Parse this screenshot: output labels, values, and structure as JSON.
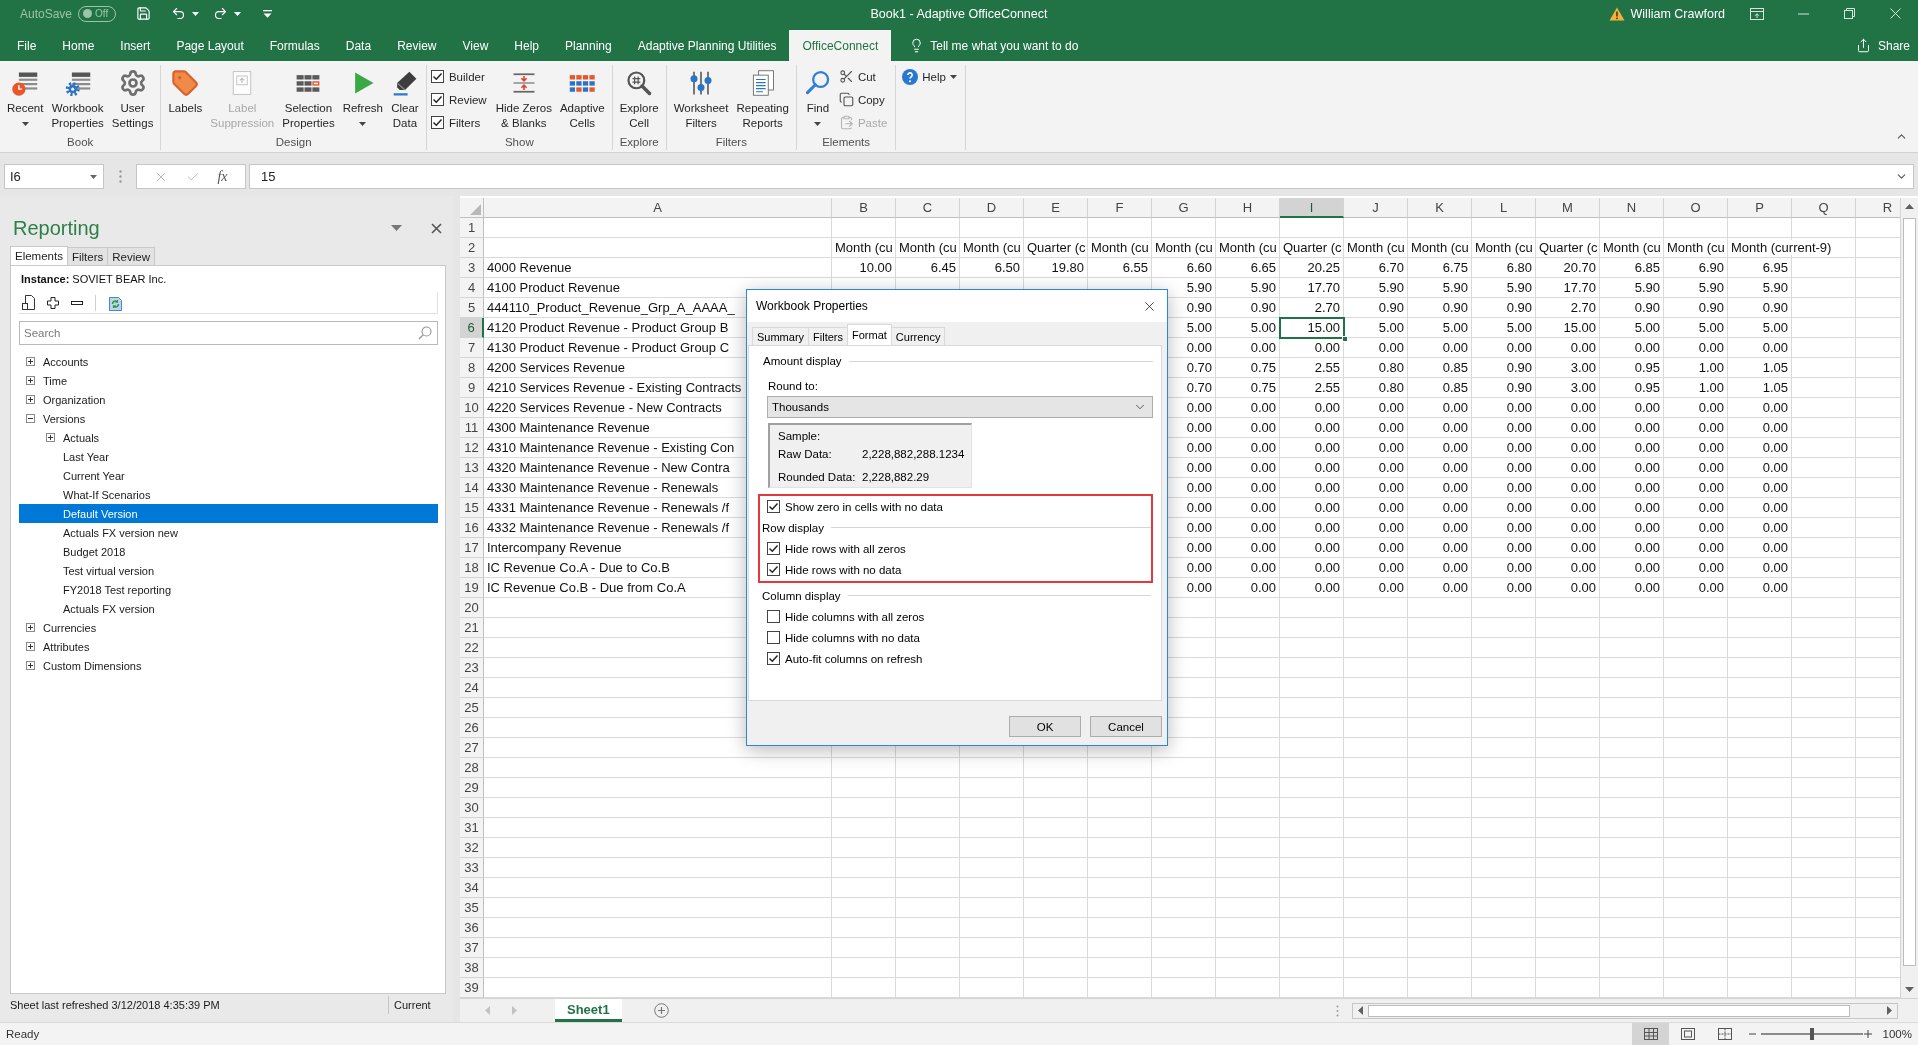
{
  "title_bar": {
    "autosave_label": "AutoSave",
    "autosave_toggle": {
      "label": "Off",
      "on": false
    },
    "title": "Book1 - Adaptive OfficeConnect",
    "user": "William Crawford"
  },
  "menu_tabs": [
    {
      "label": "File",
      "selected": false
    },
    {
      "label": "Home",
      "selected": false
    },
    {
      "label": "Insert",
      "selected": false
    },
    {
      "label": "Page Layout",
      "selected": false
    },
    {
      "label": "Formulas",
      "selected": false
    },
    {
      "label": "Data",
      "selected": false
    },
    {
      "label": "Review",
      "selected": false
    },
    {
      "label": "View",
      "selected": false
    },
    {
      "label": "Help",
      "selected": false
    },
    {
      "label": "Planning",
      "selected": false
    },
    {
      "label": "Adaptive Planning Utilities",
      "selected": false
    },
    {
      "label": "OfficeConnect",
      "selected": true
    }
  ],
  "tell_me": "Tell me what you want to do",
  "share": "Share",
  "ribbon": {
    "groups": [
      {
        "label": "Book",
        "items": [
          {
            "kind": "large",
            "label": "Recent",
            "dropdown": true,
            "disabled": false
          },
          {
            "kind": "large",
            "label": "Workbook\nProperties",
            "dropdown": false,
            "disabled": false
          },
          {
            "kind": "large",
            "label": "User\nSettings",
            "dropdown": false,
            "disabled": false
          }
        ]
      },
      {
        "label": "Design",
        "items": [
          {
            "kind": "large",
            "label": "Labels",
            "dropdown": false,
            "disabled": false
          },
          {
            "kind": "large",
            "label": "Label\nSuppression",
            "dropdown": false,
            "disabled": true
          },
          {
            "kind": "large",
            "label": "Selection\nProperties",
            "dropdown": false,
            "disabled": false
          },
          {
            "kind": "large",
            "label": "Refresh",
            "dropdown": true,
            "disabled": false
          },
          {
            "kind": "large",
            "label": "Clear\nData",
            "dropdown": false,
            "disabled": false
          }
        ]
      },
      {
        "label": "Show",
        "items": [
          {
            "kind": "check",
            "label": "Builder",
            "checked": true
          },
          {
            "kind": "check",
            "label": "Review",
            "checked": true
          },
          {
            "kind": "check",
            "label": "Filters",
            "checked": true
          },
          {
            "kind": "large",
            "label": "Hide Zeros\n& Blanks",
            "dropdown": false,
            "disabled": false
          },
          {
            "kind": "large",
            "label": "Adaptive\nCells",
            "dropdown": false,
            "disabled": false
          }
        ]
      },
      {
        "label": "Explore",
        "items": [
          {
            "kind": "large",
            "label": "Explore\nCell",
            "dropdown": false,
            "disabled": false
          }
        ]
      },
      {
        "label": "Filters",
        "items": [
          {
            "kind": "large",
            "label": "Worksheet\nFilters",
            "dropdown": false,
            "disabled": false
          },
          {
            "kind": "large",
            "label": "Repeating\nReports",
            "dropdown": false,
            "disabled": false
          }
        ]
      },
      {
        "label": "Elements",
        "items": [
          {
            "kind": "large",
            "label": "Find",
            "dropdown": true,
            "disabled": false
          },
          {
            "kind": "small",
            "label": "Cut",
            "dropdown": false,
            "disabled": false
          },
          {
            "kind": "small",
            "label": "Copy",
            "dropdown": false,
            "disabled": false
          },
          {
            "kind": "small",
            "label": "Paste",
            "dropdown": false,
            "disabled": true
          }
        ]
      },
      {
        "items": [
          {
            "kind": "small",
            "label": "Help",
            "dropdown": true,
            "disabled": false
          }
        ]
      }
    ]
  },
  "formula_bar": {
    "name_box": "I6",
    "function_label": "fx",
    "formula": "15"
  },
  "task_pane": {
    "title": "Reporting",
    "tabs": [
      {
        "label": "Elements",
        "selected": true
      },
      {
        "label": "Filters",
        "selected": false
      },
      {
        "label": "Review",
        "selected": false
      }
    ],
    "instance": "**Instance:** SOVIET BEAR Inc.",
    "search": {
      "placeholder": "Search"
    },
    "tree": [
      {
        "kind": "folder",
        "label": "Accounts",
        "expanded": false,
        "selected": false
      },
      {
        "kind": "folder",
        "label": "Time",
        "expanded": false,
        "selected": false
      },
      {
        "kind": "folder",
        "label": "Organization",
        "expanded": false,
        "selected": false
      },
      {
        "kind": "folder",
        "label": "Versions",
        "expanded": true,
        "selected": false,
        "children": [
          {
            "kind": "folder",
            "label": "Actuals",
            "expanded": false,
            "selected": false
          },
          {
            "kind": "leaf",
            "label": "Last Year",
            "selected": false
          },
          {
            "kind": "leaf",
            "label": "Current Year",
            "selected": false
          },
          {
            "kind": "leaf",
            "label": "What-If Scenarios",
            "selected": false
          },
          {
            "kind": "leaf",
            "label": "Default Version",
            "selected": true
          },
          {
            "kind": "leaf",
            "label": "Actuals FX version new",
            "selected": false
          },
          {
            "kind": "leaf",
            "label": "Budget 2018",
            "selected": false
          },
          {
            "kind": "leaf",
            "label": "Test virtual version",
            "selected": false
          },
          {
            "kind": "leaf",
            "label": "FY2018 Test reporting",
            "selected": false
          },
          {
            "kind": "leaf",
            "label": "Actuals FX version",
            "selected": false
          }
        ]
      },
      {
        "kind": "folder",
        "label": "Currencies",
        "expanded": false,
        "selected": false
      },
      {
        "kind": "folder",
        "label": "Attributes",
        "expanded": false,
        "selected": false
      },
      {
        "kind": "folder",
        "label": "Custom Dimensions",
        "expanded": false,
        "selected": false
      }
    ],
    "footer": {
      "status": "Sheet last refreshed 3/12/2018 4:35:39 PM",
      "version": "Current"
    }
  },
  "sheet": {
    "columns": [
      {
        "letter": "A",
        "selected": false
      },
      {
        "letter": "B",
        "selected": false
      },
      {
        "letter": "C",
        "selected": false
      },
      {
        "letter": "D",
        "selected": false
      },
      {
        "letter": "E",
        "selected": false
      },
      {
        "letter": "F",
        "selected": false
      },
      {
        "letter": "G",
        "selected": false
      },
      {
        "letter": "H",
        "selected": false
      },
      {
        "letter": "I",
        "selected": true
      },
      {
        "letter": "J",
        "selected": false
      },
      {
        "letter": "K",
        "selected": false
      },
      {
        "letter": "L",
        "selected": false
      },
      {
        "letter": "M",
        "selected": false
      },
      {
        "letter": "N",
        "selected": false
      },
      {
        "letter": "O",
        "selected": false
      },
      {
        "letter": "P",
        "selected": false
      },
      {
        "letter": "Q",
        "selected": false
      },
      {
        "letter": "R",
        "selected": false
      }
    ],
    "rows": [
      {
        "number": "1",
        "kind": "blank",
        "selected": false
      },
      {
        "number": "2",
        "kind": "heading",
        "selected": false,
        "values": [
          "Month (cu",
          "Month (cu",
          "Month (cu",
          "Quarter (c",
          "Month (cu",
          "Month (cu",
          "Month (cu",
          "Quarter (c",
          "Month (cu",
          "Month (cu",
          "Month (cu",
          "Quarter (c",
          "Month (cu",
          "Month (cu",
          "Month (current-9)"
        ]
      },
      {
        "number": "3",
        "kind": "data",
        "selected": false,
        "label": "4000 Revenue",
        "values": [
          "10.00",
          "6.45",
          "6.50",
          "19.80",
          "6.55",
          "6.60",
          "6.65",
          "20.25",
          "6.70",
          "6.75",
          "6.80",
          "20.70",
          "6.85",
          "6.90",
          "6.95"
        ]
      },
      {
        "number": "4",
        "kind": "data",
        "selected": false,
        "label": "4100 Product Revenue",
        "values": [
          "5.90",
          "5.90",
          "17.70",
          "5.90",
          "5.90",
          "5.90",
          "17.70",
          "5.90",
          "5.90",
          "5.90"
        ]
      },
      {
        "number": "5",
        "kind": "data",
        "selected": false,
        "label": "444110_Product_Revenue_Grp_A_AAAA_",
        "values": [
          "0.90",
          "0.90",
          "2.70",
          "0.90",
          "0.90",
          "0.90",
          "2.70",
          "0.90",
          "0.90",
          "0.90"
        ]
      },
      {
        "number": "6",
        "kind": "data",
        "selected": true,
        "label": "4120 Product Revenue - Product Group B",
        "values": [
          "5.00",
          "5.00",
          "15.00",
          "5.00",
          "5.00",
          "5.00",
          "15.00",
          "5.00",
          "5.00",
          "5.00"
        ]
      },
      {
        "number": "7",
        "kind": "data",
        "selected": false,
        "label": "4130 Product Revenue - Product Group C",
        "values": [
          "0.00",
          "0.00",
          "0.00",
          "0.00",
          "0.00",
          "0.00",
          "0.00",
          "0.00",
          "0.00",
          "0.00"
        ]
      },
      {
        "number": "8",
        "kind": "data",
        "selected": false,
        "label": "4200 Services Revenue",
        "values": [
          "0.70",
          "0.75",
          "2.55",
          "0.80",
          "0.85",
          "0.90",
          "3.00",
          "0.95",
          "1.00",
          "1.05"
        ]
      },
      {
        "number": "9",
        "kind": "data",
        "selected": false,
        "label": "4210 Services Revenue - Existing Contracts",
        "values": [
          "0.70",
          "0.75",
          "2.55",
          "0.80",
          "0.85",
          "0.90",
          "3.00",
          "0.95",
          "1.00",
          "1.05"
        ]
      },
      {
        "number": "10",
        "kind": "data",
        "selected": false,
        "label": "4220 Services Revenue - New Contracts",
        "values": [
          "0.00",
          "0.00",
          "0.00",
          "0.00",
          "0.00",
          "0.00",
          "0.00",
          "0.00",
          "0.00",
          "0.00"
        ]
      },
      {
        "number": "11",
        "kind": "data",
        "selected": false,
        "label": "4300 Maintenance Revenue",
        "values": [
          "0.00",
          "0.00",
          "0.00",
          "0.00",
          "0.00",
          "0.00",
          "0.00",
          "0.00",
          "0.00",
          "0.00"
        ]
      },
      {
        "number": "12",
        "kind": "data",
        "selected": false,
        "label": "4310 Maintenance Revenue - Existing Con",
        "values": [
          "0.00",
          "0.00",
          "0.00",
          "0.00",
          "0.00",
          "0.00",
          "0.00",
          "0.00",
          "0.00",
          "0.00"
        ]
      },
      {
        "number": "13",
        "kind": "data",
        "selected": false,
        "label": "4320 Maintenance Revenue - New Contra",
        "values": [
          "0.00",
          "0.00",
          "0.00",
          "0.00",
          "0.00",
          "0.00",
          "0.00",
          "0.00",
          "0.00",
          "0.00"
        ]
      },
      {
        "number": "14",
        "kind": "data",
        "selected": false,
        "label": "4330 Maintenance Revenue - Renewals",
        "values": [
          "0.00",
          "0.00",
          "0.00",
          "0.00",
          "0.00",
          "0.00",
          "0.00",
          "0.00",
          "0.00",
          "0.00"
        ]
      },
      {
        "number": "15",
        "kind": "data",
        "selected": false,
        "label": "4331 Maintenance Revenue - Renewals /f",
        "values": [
          "0.00",
          "0.00",
          "0.00",
          "0.00",
          "0.00",
          "0.00",
          "0.00",
          "0.00",
          "0.00",
          "0.00"
        ]
      },
      {
        "number": "16",
        "kind": "data",
        "selected": false,
        "label": "4332 Maintenance Revenue - Renewals /f",
        "values": [
          "0.00",
          "0.00",
          "0.00",
          "0.00",
          "0.00",
          "0.00",
          "0.00",
          "0.00",
          "0.00",
          "0.00"
        ]
      },
      {
        "number": "17",
        "kind": "data",
        "selected": false,
        "label": "Intercompany Revenue",
        "values": [
          "0.00",
          "0.00",
          "0.00",
          "0.00",
          "0.00",
          "0.00",
          "0.00",
          "0.00",
          "0.00",
          "0.00"
        ]
      },
      {
        "number": "18",
        "kind": "data",
        "selected": false,
        "label": "IC Revenue Co.A - Due to Co.B",
        "values": [
          "0.00",
          "0.00",
          "0.00",
          "0.00",
          "0.00",
          "0.00",
          "0.00",
          "0.00",
          "0.00",
          "0.00"
        ]
      },
      {
        "number": "19",
        "kind": "data",
        "selected": false,
        "label": "IC Revenue Co.B - Due from Co.A",
        "values": [
          "0.00",
          "0.00",
          "0.00",
          "0.00",
          "0.00",
          "0.00",
          "0.00",
          "0.00",
          "0.00",
          "0.00"
        ]
      },
      {
        "number": "20",
        "kind": "blank",
        "selected": false
      },
      {
        "number": "21",
        "kind": "blank",
        "selected": false
      },
      {
        "number": "22",
        "kind": "blank",
        "selected": false
      },
      {
        "number": "23",
        "kind": "blank",
        "selected": false
      },
      {
        "number": "24",
        "kind": "blank",
        "selected": false
      },
      {
        "number": "25",
        "kind": "blank",
        "selected": false
      },
      {
        "number": "26",
        "kind": "blank",
        "selected": false
      },
      {
        "number": "27",
        "kind": "blank",
        "selected": false
      },
      {
        "number": "28",
        "kind": "blank",
        "selected": false
      },
      {
        "number": "29",
        "kind": "blank",
        "selected": false
      },
      {
        "number": "30",
        "kind": "blank",
        "selected": false
      },
      {
        "number": "31",
        "kind": "blank",
        "selected": false
      },
      {
        "number": "32",
        "kind": "blank",
        "selected": false
      },
      {
        "number": "33",
        "kind": "blank",
        "selected": false
      },
      {
        "number": "34",
        "kind": "blank",
        "selected": false
      },
      {
        "number": "35",
        "kind": "blank",
        "selected": false
      },
      {
        "number": "36",
        "kind": "blank",
        "selected": false
      },
      {
        "number": "37",
        "kind": "blank",
        "selected": false
      },
      {
        "number": "38",
        "kind": "blank",
        "selected": false
      },
      {
        "number": "39",
        "kind": "blank",
        "selected": false
      }
    ]
  },
  "dialog": {
    "title": "Workbook Properties",
    "tabs": [
      {
        "label": "Summary",
        "selected": false
      },
      {
        "label": "Filters",
        "selected": false
      },
      {
        "label": "Format",
        "selected": true
      },
      {
        "label": "Currency",
        "selected": false
      }
    ],
    "amount_display": {
      "heading": "Amount display",
      "round_to_label": "Round to:",
      "round_to_value": "Thousands",
      "sample": {
        "heading": "Sample:",
        "rows": [
          {
            "label": "Raw Data:",
            "value": "2,228,882,288.1234"
          },
          {
            "label": "Rounded Data:",
            "value": "2,228,882.29"
          }
        ]
      }
    },
    "sections": [
      {
        "kind": "highlight",
        "items": [
          {
            "kind": "check",
            "label": "Show zero in cells with no data",
            "checked": true
          },
          {
            "kind": "heading",
            "label": "Row display"
          },
          {
            "kind": "check",
            "label": "Hide rows with all zeros",
            "checked": true
          },
          {
            "kind": "check",
            "label": "Hide rows with no data",
            "checked": true
          }
        ]
      },
      {
        "kind": "plain",
        "items": [
          {
            "kind": "heading",
            "label": "Column display"
          },
          {
            "kind": "check",
            "label": "Hide columns with all zeros",
            "checked": false
          },
          {
            "kind": "check",
            "label": "Hide columns with no data",
            "checked": false
          },
          {
            "kind": "check",
            "label": "Auto-fit columns on refresh",
            "checked": true
          }
        ]
      }
    ],
    "buttons": [
      {
        "label": "OK"
      },
      {
        "label": "Cancel"
      }
    ]
  },
  "sheet_tabs": [
    {
      "label": "Sheet1",
      "selected": true
    }
  ],
  "status_bar": {
    "status": "Ready",
    "views": [
      {
        "selected": true
      },
      {
        "selected": false
      },
      {
        "selected": false
      }
    ],
    "zoom": {
      "level": 0.5,
      "label": "100%"
    }
  }
}
